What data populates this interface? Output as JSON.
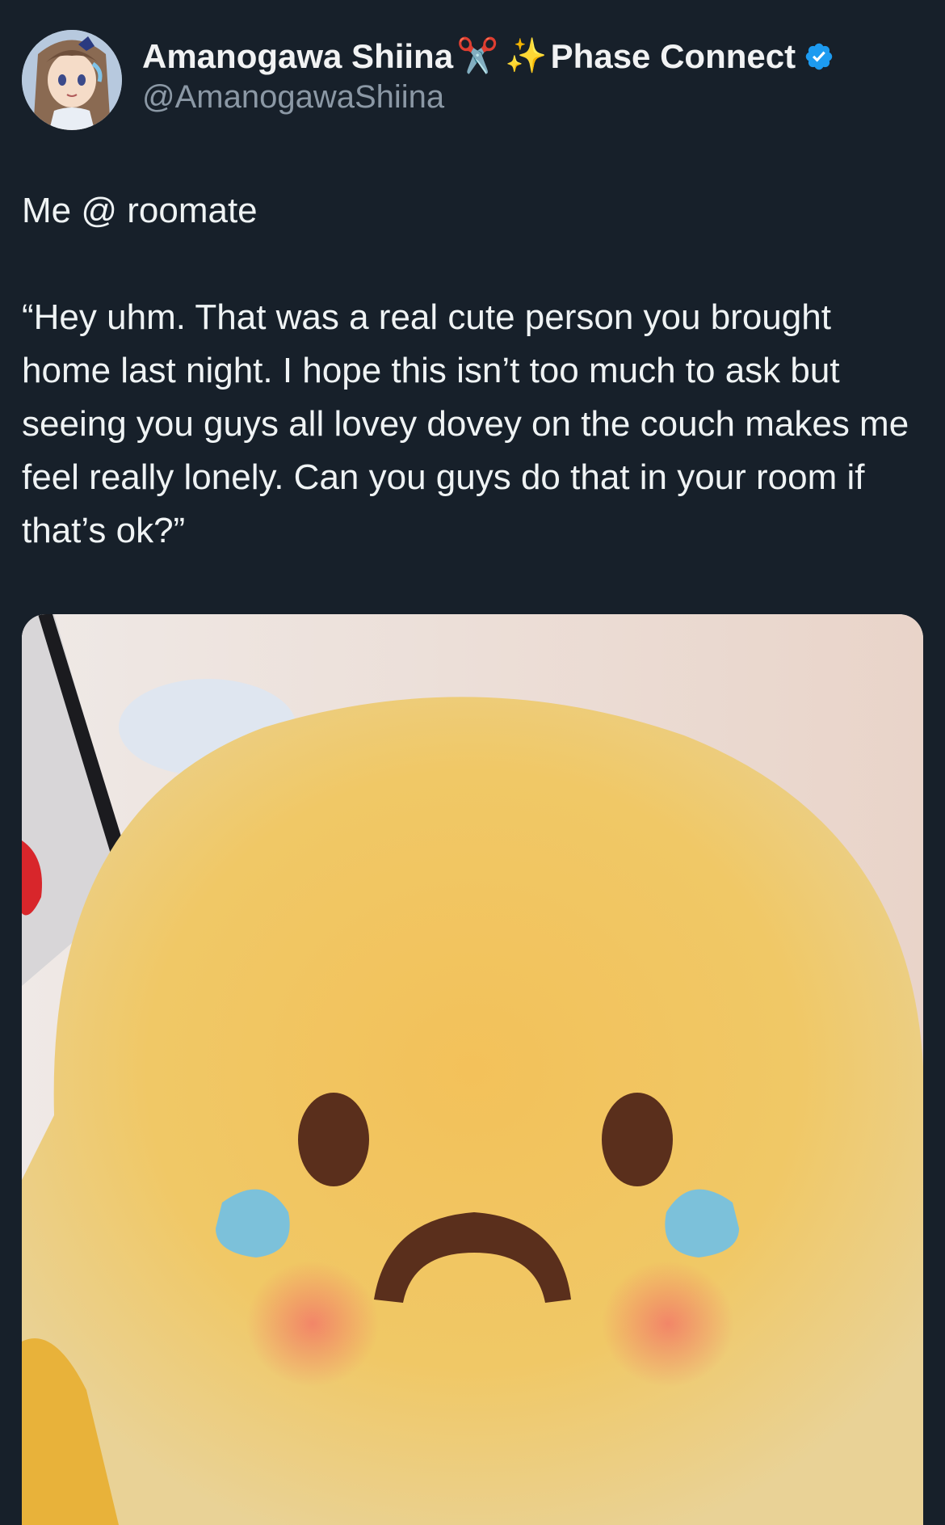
{
  "author": {
    "display_name_part1": "Amanogawa Shiina",
    "emoji1": "✂️",
    "emoji2": "✨",
    "display_name_part2": "Phase Connect",
    "handle": "@AmanogawaShiina",
    "verified_icon": "verified-badge-icon",
    "verified_color": "#1d9bf0"
  },
  "tweet": {
    "line1": "Me @ roomate",
    "body": "“Hey uhm. That was a real cute person you brought home last night. I hope this isn’t too much to ask but seeing you guys all lovey dovey on the couch makes me feel really lonely. Can you guys do that in your room if that’s ok?”"
  },
  "media": {
    "subject": "crying-plush-photo"
  },
  "colors": {
    "background": "#17202a",
    "text": "#eff3f4",
    "handle": "#8b98a5"
  }
}
